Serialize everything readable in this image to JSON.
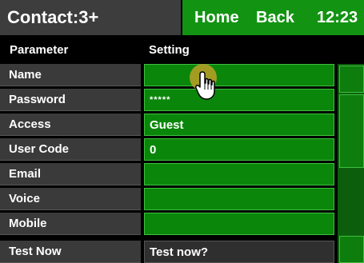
{
  "header": {
    "title": "Contact:3+",
    "home_label": "Home",
    "back_label": "Back",
    "time": "12:23"
  },
  "columns": {
    "parameter": "Parameter",
    "setting": "Setting"
  },
  "rows": [
    {
      "label": "Name",
      "value": ""
    },
    {
      "label": "Password",
      "value": "*****"
    },
    {
      "label": "Access",
      "value": "Guest"
    },
    {
      "label": "User Code",
      "value": "0"
    },
    {
      "label": "Email",
      "value": ""
    },
    {
      "label": "Voice",
      "value": ""
    },
    {
      "label": "Mobile",
      "value": ""
    },
    {
      "label": "Test Now",
      "value": "Test now?"
    }
  ],
  "icons": {
    "cursor": "hand-pointer-icon"
  },
  "colors": {
    "nav_green": "#129412",
    "value_green": "#0a870a",
    "label_gray": "#3a3a3a"
  }
}
